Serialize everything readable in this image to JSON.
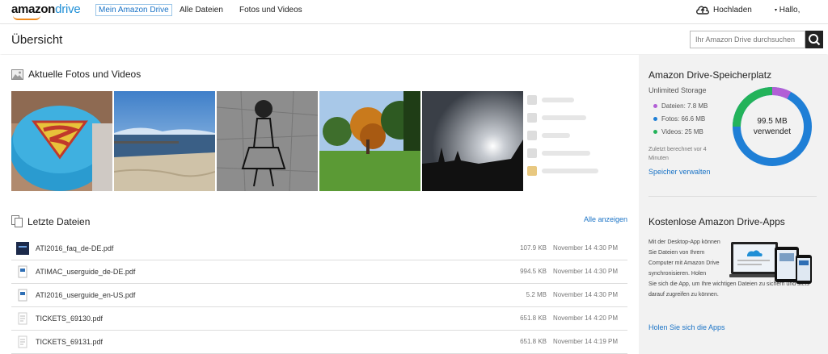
{
  "nav": {
    "logo_amazon": "amazon",
    "logo_drive": "drive",
    "links": [
      "Mein Amazon Drive",
      "Alle Dateien",
      "Fotos und Videos"
    ],
    "upload_label": "Hochladen",
    "hello_label": "Hallo,"
  },
  "header": {
    "title": "Übersicht",
    "search_placeholder": "Ihr Amazon Drive durchsuchen"
  },
  "photos_section": {
    "title": "Aktuelle Fotos und Videos"
  },
  "files_section": {
    "title": "Letzte Dateien",
    "all_label": "Alle anzeigen",
    "files": [
      {
        "name": "ATI2016_faq_de-DE.pdf",
        "size": "107.9 KB",
        "date": "November 14   4:30 PM"
      },
      {
        "name": "ATIMAC_userguide_de-DE.pdf",
        "size": "994.5 KB",
        "date": "November 14   4:30 PM"
      },
      {
        "name": "ATI2016_userguide_en-US.pdf",
        "size": "5.2 MB",
        "date": "November 14   4:30 PM"
      },
      {
        "name": "TICKETS_69130.pdf",
        "size": "651.8 KB",
        "date": "November 14   4:20 PM"
      },
      {
        "name": "TICKETS_69131.pdf",
        "size": "651.8 KB",
        "date": "November 14   4:19 PM"
      }
    ]
  },
  "storage": {
    "title": "Amazon Drive-Speicherplatz",
    "subtitle": "Unlimited Storage",
    "legend": [
      {
        "label": "Dateien: 7.8 MB",
        "color": "#b25fd6"
      },
      {
        "label": "Fotos: 66.6 MB",
        "color": "#1f7fd6"
      },
      {
        "label": "Videos: 25 MB",
        "color": "#23b35a"
      }
    ],
    "donut_value": "99.5 MB",
    "donut_label": "verwendet",
    "calc_note": "Zuletzt berechnet vor 4 Minuten",
    "manage_label": "Speicher verwalten"
  },
  "apps": {
    "title": "Kostenlose Amazon Drive-Apps",
    "text_narrow": "Mit der Desktop-App können Sie Dateien von Ihrem Computer mit Amazon Drive synchronisieren. Holen",
    "text_wide": "Sie sich die App, um Ihre wichtigen Dateien zu sichern und stets darauf zugreifen zu können.",
    "link_label": "Holen Sie sich die Apps"
  },
  "colors": {
    "accent": "#1a73c6",
    "files": "#b25fd6",
    "photos": "#1f7fd6",
    "videos": "#23b35a"
  }
}
